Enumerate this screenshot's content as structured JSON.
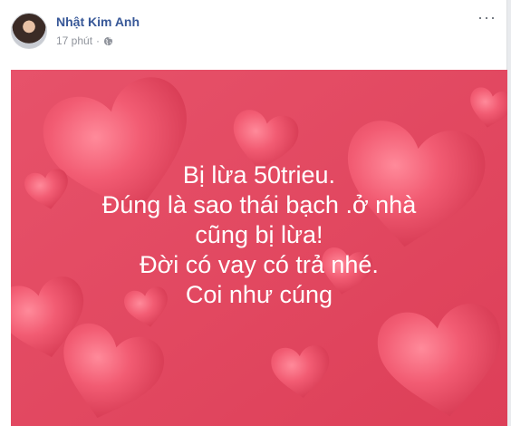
{
  "post": {
    "author": "Nhật Kim Anh",
    "time": "17 phút",
    "dot": "·",
    "privacy_icon": "globe-icon",
    "more_icon": "more-options-icon",
    "more_label": "···",
    "lines": [
      "Bị lừa 50trieu.",
      "Đúng là sao thái bạch .ở nhà",
      "cũng bị lừa!",
      "Đời có vay có trả nhé.",
      "Coi như cúng"
    ]
  },
  "colors": {
    "background": "#e24a62",
    "heart": "#f05a72",
    "text": "#ffffff",
    "author": "#385898",
    "meta": "#90949c"
  }
}
